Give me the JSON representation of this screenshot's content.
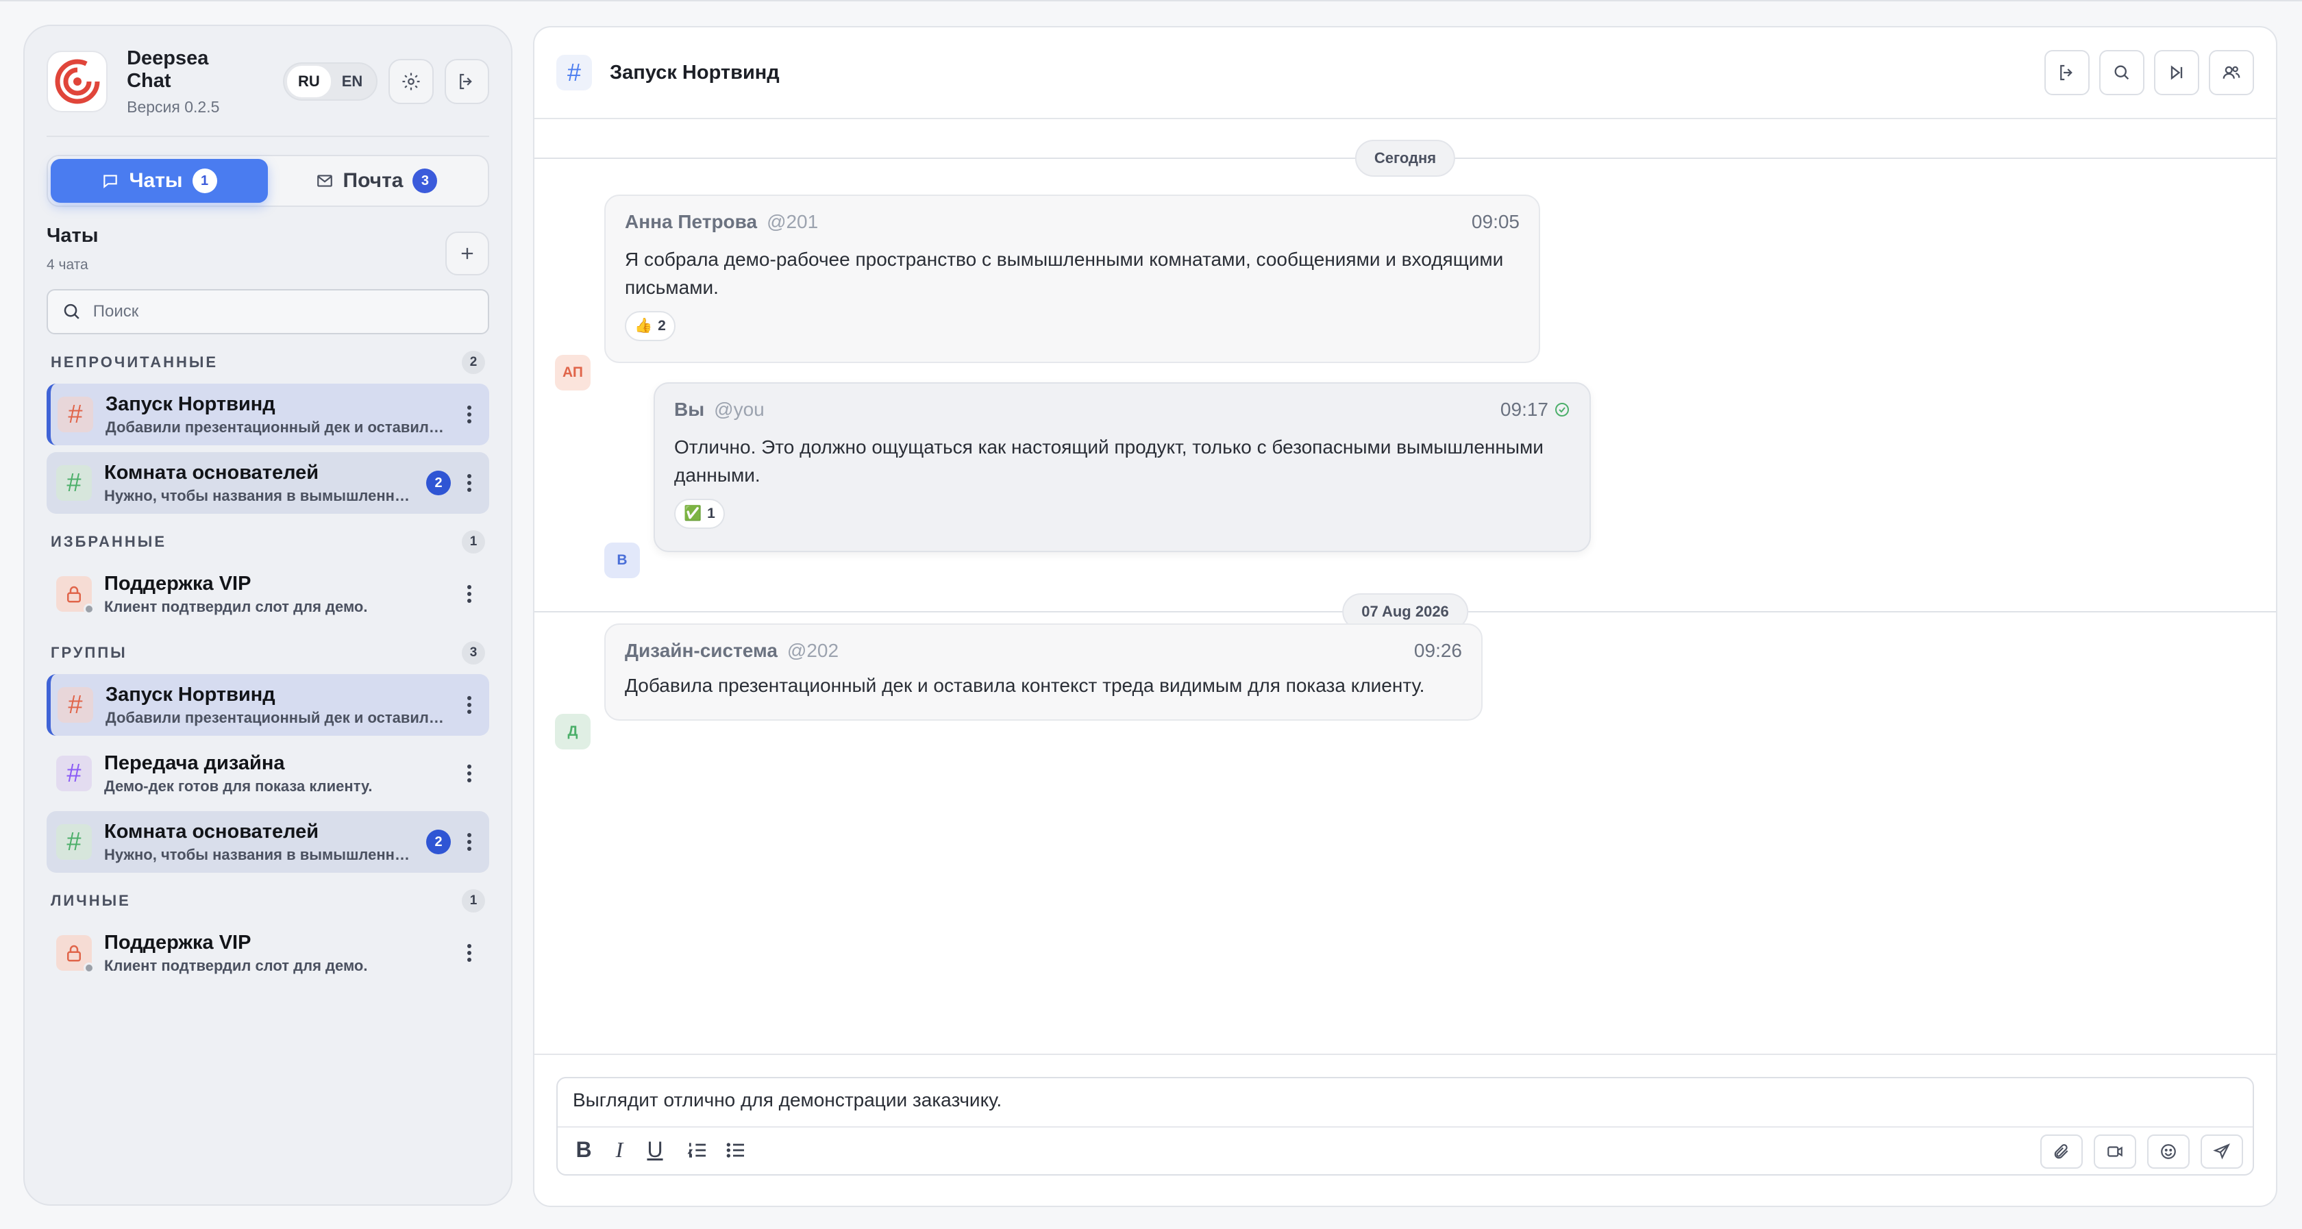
{
  "app": {
    "name": "Deepsea Chat",
    "version": "Версия 0.2.5"
  },
  "lang": {
    "ru": "RU",
    "en": "EN"
  },
  "tabs": [
    {
      "label": "Чаты",
      "badge": "1"
    },
    {
      "label": "Почта",
      "badge": "3"
    }
  ],
  "chats": {
    "title": "Чаты",
    "count": "4 чата"
  },
  "search": {
    "placeholder": "Поиск"
  },
  "sections": {
    "unread": {
      "label": "НЕПРОЧИТАННЫЕ",
      "count": "2",
      "items": [
        {
          "name": "Запуск Нортвинд",
          "preview": "Добавили презентационный дек и оставили контекст треда"
        },
        {
          "name": "Комната основателей",
          "preview": "Нужно, чтобы названия в вымышленных данных",
          "badge": "2"
        }
      ]
    },
    "favorites": {
      "label": "ИЗБРАННЫЕ",
      "count": "1",
      "items": [
        {
          "name": "Поддержка VIP",
          "preview": "Клиент подтвердил слот для демо."
        }
      ]
    },
    "groups": {
      "label": "ГРУППЫ",
      "count": "3",
      "items": [
        {
          "name": "Запуск Нортвинд",
          "preview": "Добавили презентационный дек и оставили контекст треда"
        },
        {
          "name": "Передача дизайна",
          "preview": "Демо-дек готов для показа клиенту."
        },
        {
          "name": "Комната основателей",
          "preview": "Нужно, чтобы названия в вымышленных данных",
          "badge": "2"
        }
      ]
    },
    "personal": {
      "label": "ЛИЧНЫЕ",
      "count": "1",
      "items": [
        {
          "name": "Поддержка VIP",
          "preview": "Клиент подтвердил слот для демо."
        }
      ]
    }
  },
  "room": {
    "title": "Запуск Нортвинд"
  },
  "dates": {
    "today": "Сегодня",
    "second": "07 Aug 2026"
  },
  "messages": [
    {
      "initials": "АП",
      "author": "Анна Петрова",
      "handle": "@201",
      "time": "09:05",
      "text": "Я собрала демо-рабочее пространство с вымышленными комнатами, сообщениями и входящими письмами.",
      "reaction": {
        "emoji": "👍",
        "count": "2"
      }
    },
    {
      "initials": "В",
      "author": "Вы",
      "handle": "@you",
      "time": "09:17",
      "text": "Отлично. Это должно ощущаться как настоящий продукт, только с безопасными вымышленными данными.",
      "reaction": {
        "emoji": "✅",
        "count": "1"
      }
    },
    {
      "initials": "Д",
      "author": "Дизайн-система",
      "handle": "@202",
      "time": "09:26",
      "text": "Добавила презентационный дек и оставила контекст треда видимым для показа клиенту."
    }
  ],
  "composer": {
    "text": "Выглядит отлично для демонстрации заказчику."
  },
  "colors": {
    "accent": "#4a7cf0",
    "badge": "#2f55d4",
    "brand": "#e0453a"
  }
}
